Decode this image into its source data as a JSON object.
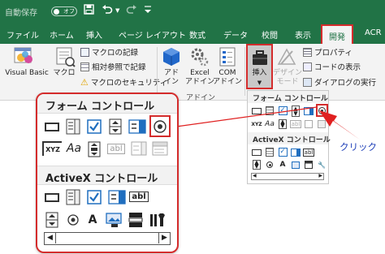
{
  "titlebar": {
    "autosave_label": "自動保存",
    "autosave_state": "オフ",
    "icons": [
      "save-icon",
      "undo-icon",
      "redo-icon",
      "customize-icon"
    ]
  },
  "tabs": [
    "ファイル",
    "ホーム",
    "挿入",
    "ページ レイアウト",
    "数式",
    "データ",
    "校閲",
    "表示",
    "開発",
    "ACR"
  ],
  "active_tab": "開発",
  "ribbon": {
    "code": {
      "visual_basic": "Visual Basic",
      "macro": "マクロ",
      "record_macro": "マクロの記録",
      "relative_refs": "相対参照で記録",
      "macro_security": "マクロのセキュリティ"
    },
    "addins": {
      "addins_line1": "アド",
      "addins_line2": "イン",
      "excel_addins_line1": "Excel",
      "excel_addins_line2": "アドイン",
      "com_addins_line1": "COM",
      "com_addins_line2": "アドイン",
      "group_label": "アドイン"
    },
    "controls": {
      "insert_label": "挿入",
      "design_mode_line1": "デザイン",
      "design_mode_line2": "モード",
      "properties": "プロパティ",
      "view_code": "コードの表示",
      "run_dialog": "ダイアログの実行"
    }
  },
  "dropdown": {
    "form_controls_header": "フォーム コントロール",
    "activex_header": "ActiveX コントロール"
  },
  "callout": {
    "form_controls_header": "フォーム コントロール",
    "activex_header": "ActiveX コントロール",
    "aa_label": "Aa",
    "abl_label": "abl",
    "a_label": "A",
    "xyz_label": "XYZ"
  },
  "annotation": {
    "click_text": "クリック",
    "arrow_color": "#e02020"
  },
  "colors": {
    "excel_green": "#217346",
    "highlight_red": "#d42c2c",
    "check_blue": "#1f6ebf"
  }
}
